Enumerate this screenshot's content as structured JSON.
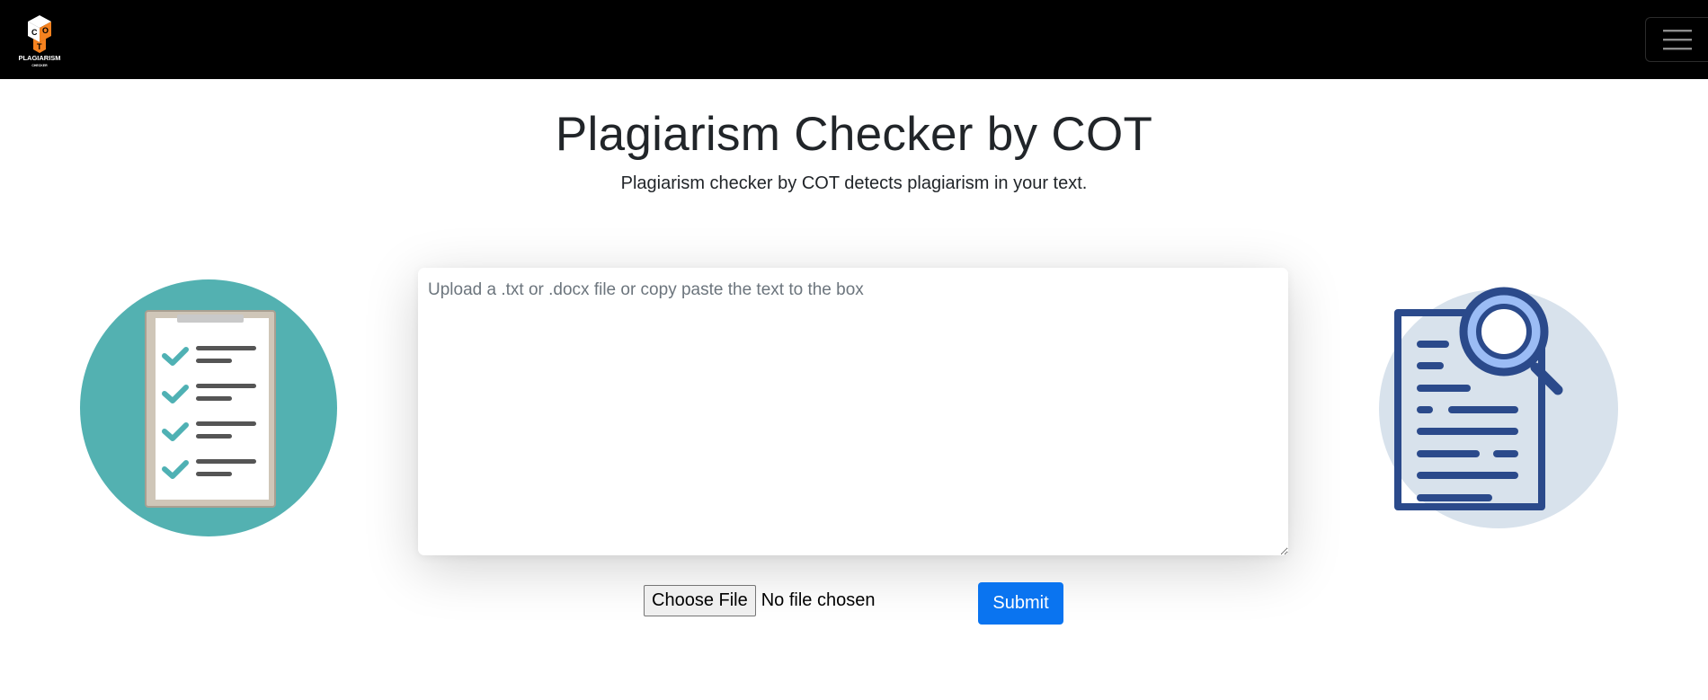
{
  "navbar": {
    "logo_text": "PLAGIARISM",
    "logo_subtext": "CHECKER",
    "logo_letters": [
      "C",
      "O",
      "T"
    ],
    "toggler_icon": "hamburger-menu-icon"
  },
  "header": {
    "title": "Plagiarism Checker by COT",
    "subtitle": "Plagiarism checker by COT detects plagiarism in your text."
  },
  "editor": {
    "placeholder": "Upload a .txt or .docx file or copy paste the text to the box",
    "value": ""
  },
  "upload": {
    "choose_label": "Choose File",
    "status": "No file chosen"
  },
  "actions": {
    "submit_label": "Submit"
  },
  "illustrations": {
    "left": "checklist-clipboard-icon",
    "right": "document-search-icon"
  },
  "colors": {
    "navbar_bg": "#000000",
    "logo_accent": "#f5821f",
    "submit_bg": "#0a74f0",
    "left_circle": "#53b1b1",
    "right_circle": "#d8e2ec",
    "doc_stroke": "#2b4a8b",
    "lens_fill": "#9bbcf5"
  }
}
